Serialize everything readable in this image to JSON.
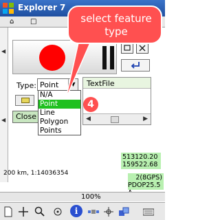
{
  "window": {
    "title": "Explorer 7",
    "title_right": ""
  },
  "menu_strip": {
    "items": [
      "⌂",
      "□",
      "▶",
      "="
    ]
  },
  "type_field": {
    "label": "Type:",
    "value": "Point"
  },
  "type_options": [
    {
      "label": "N/A"
    },
    {
      "label": "Point",
      "selected": true
    },
    {
      "label": "Line"
    },
    {
      "label": "Polygon"
    },
    {
      "label": "Points"
    }
  ],
  "textfile_panel": {
    "label": "TextFile"
  },
  "close_button": {
    "label": "Close"
  },
  "map_info": {
    "scale": "200 km, 1:14036354",
    "coord_x": "513120.20",
    "coord_y": "159522.68",
    "gps_line1": "2(8GPS)",
    "gps_line2": "PDOP25.5 A"
  },
  "status_bar": {
    "zoom": "100%"
  },
  "callout": {
    "line1": "select feature",
    "line2": "type",
    "color": "#ff5050"
  },
  "step_badge": {
    "number": "4"
  },
  "colors": {
    "record": "#ff0000",
    "selection": "#20c020",
    "coords_bg": "#b8f0b0",
    "title_bar": "#2b5fb8"
  },
  "icons": [
    "windows-logo-icon",
    "record-icon",
    "pause-icon",
    "undo-icon",
    "folder-icon",
    "info-icon"
  ]
}
